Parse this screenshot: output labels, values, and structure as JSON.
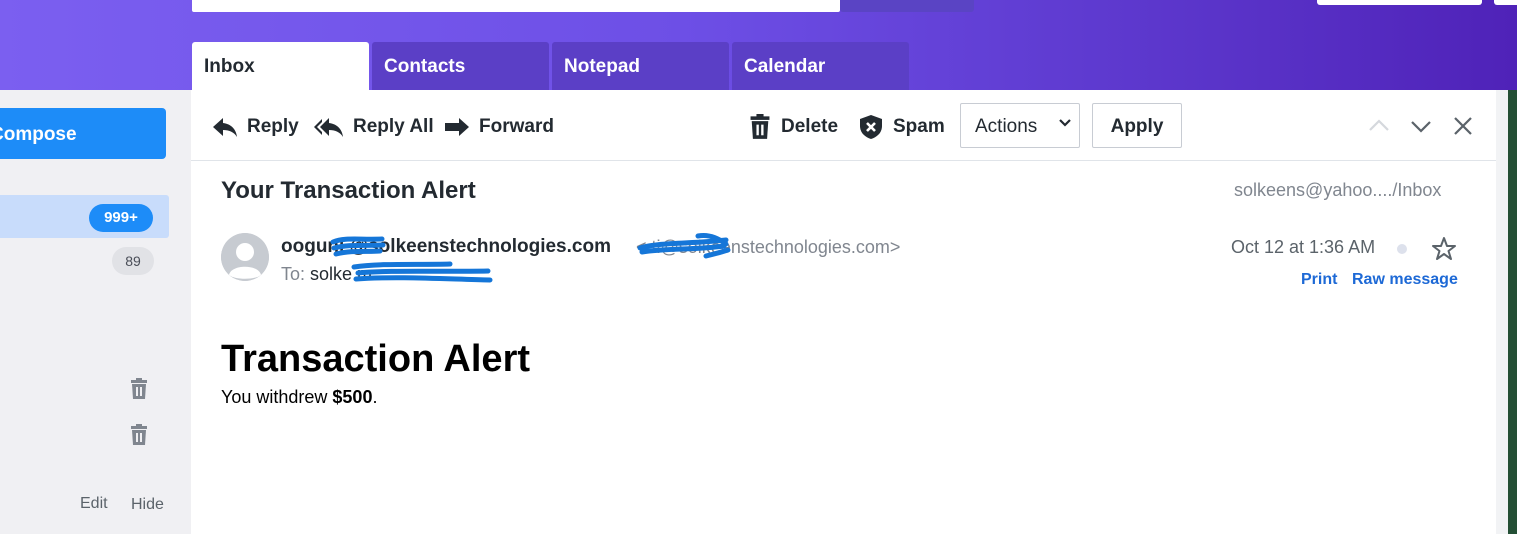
{
  "tabs": [
    {
      "label": "Inbox",
      "active": true
    },
    {
      "label": "Contacts",
      "active": false
    },
    {
      "label": "Notepad",
      "active": false
    },
    {
      "label": "Calendar",
      "active": false
    }
  ],
  "sidebar": {
    "compose_label": "Compose",
    "inbox_count": "999+",
    "unread_count": "89",
    "edit_label": "Edit",
    "hide_label": "Hide"
  },
  "toolbar": {
    "reply_label": "Reply",
    "reply_all_label": "Reply All",
    "forward_label": "Forward",
    "delete_label": "Delete",
    "spam_label": "Spam",
    "actions_value": "Actions",
    "apply_label": "Apply"
  },
  "message": {
    "subject": "Your Transaction Alert",
    "folder_path": "solkeens@yahoo..../Inbox",
    "sender_name": "ooguni      @solkeenstechnologies.com",
    "sender_address": "<         ti@solkeenstechnologies.com>",
    "to_label": "To:",
    "to_value": "solke                    m",
    "date": "Oct 12 at 1:36 AM",
    "print_label": "Print",
    "raw_message_label": "Raw message",
    "body_heading": "Transaction Alert",
    "body_text_prefix": "You withdrew ",
    "body_amount": "$500",
    "body_text_suffix": "."
  },
  "colors": {
    "header_gradient_start": "#7b5ff0",
    "header_gradient_end": "#4f22b8",
    "accent_blue": "#1d8cf8",
    "link_blue": "#1d69d6",
    "redaction_blue": "#1576d8"
  },
  "icons": [
    "reply-icon",
    "reply-all-icon",
    "forward-icon",
    "trash-icon",
    "spam-shield-icon",
    "chevron-up-icon",
    "chevron-down-icon",
    "close-icon",
    "star-icon",
    "avatar-icon"
  ]
}
